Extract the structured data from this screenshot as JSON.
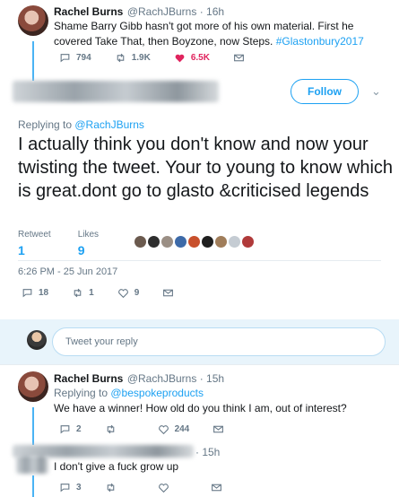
{
  "tweet1": {
    "name": "Rachel Burns",
    "handle": "@RachJBurns · 16h",
    "text_before": "Shame Barry Gibb hasn't got more of his own material. First he covered Take That, then Boyzone, now Steps. ",
    "hashtag": "#Glastonbury2017",
    "replies": "794",
    "retweets": "1.9K",
    "likes": "6.5K"
  },
  "main": {
    "follow_label": "Follow",
    "replying_prefix": "Replying to ",
    "replying_handle": "@RachJBurns",
    "text": "I actually think you don't know and now your twisting the tweet. Your to young to know which is great.dont go to glasto &criticised legends",
    "retweet_label": "Retweet",
    "likes_label": "Likes",
    "retweet_count": "1",
    "likes_count": "9",
    "timestamp": "6:26 PM - 25 Jun 2017",
    "replies": "18",
    "retweets": "1",
    "likes": "9"
  },
  "reply_box": {
    "placeholder": "Tweet your reply"
  },
  "tweet3": {
    "name": "Rachel Burns",
    "handle": "@RachJBurns · 15h",
    "replying_prefix": "Replying to ",
    "replying_handle": "@bespokeproducts",
    "text": "We have a winner! How old do you think I am, out of interest?",
    "replies": "2",
    "retweets": "",
    "likes": "244"
  },
  "tweet4": {
    "time": "· 15h",
    "text": "I don't give a fuck grow up",
    "replies": "3",
    "retweets": "",
    "likes": ""
  },
  "colors": {
    "accent": "#1da1f2",
    "like": "#e0245e",
    "muted": "#657786"
  }
}
